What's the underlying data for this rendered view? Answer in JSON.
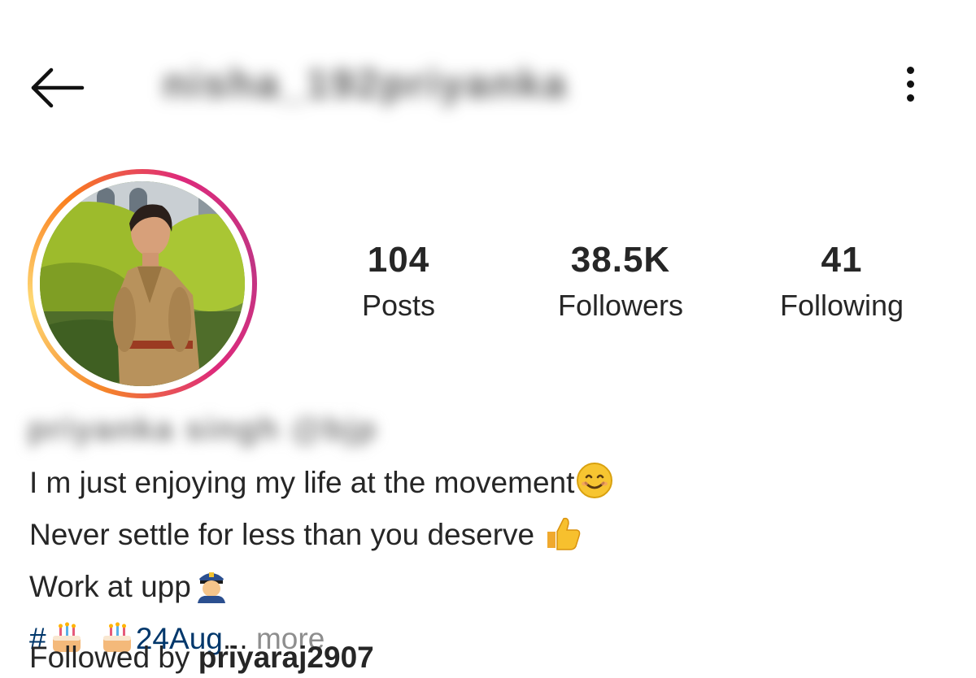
{
  "header": {
    "back_icon": "arrow-left-icon",
    "username": "nisha_192priyanka",
    "options_icon": "more-vertical-icon"
  },
  "profile": {
    "avatar_alt": "profile picture",
    "stats": [
      {
        "value": "104",
        "label": "Posts"
      },
      {
        "value": "38.5K",
        "label": "Followers"
      },
      {
        "value": "41",
        "label": "Following"
      }
    ]
  },
  "bio": {
    "name": "priyanka singh @bjp",
    "line1": "I m just enjoying my life at the movement",
    "line1_emoji": "smiling-face-icon",
    "line2": "Never settle for less than you deserve ",
    "line2_emoji": "thumbs-up-icon",
    "line3": "Work at upp",
    "line3_emoji": "police-officer-icon",
    "line4_hash": "#",
    "line4_emoji": "birthday-cake-icon",
    "line4_tag": "24Aug",
    "line4_ellipsis": "...",
    "more_label": " more"
  },
  "followed_by": {
    "prefix": "Followed by ",
    "user": "priyaraj2907"
  },
  "colors": {
    "text": "#262626",
    "hashtag": "#00376b",
    "muted": "#8e8e8e",
    "ring_start": "#f58529",
    "ring_end": "#c13584"
  }
}
